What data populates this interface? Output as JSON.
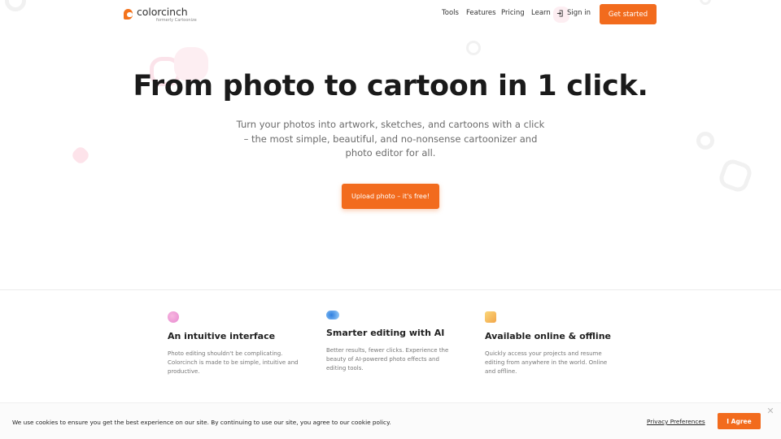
{
  "brand": {
    "name": "colorcinch",
    "tagline": "formerly Cartoonize",
    "accent_color": "#f26b1d"
  },
  "nav": {
    "items": [
      "Tools",
      "Features",
      "Pricing",
      "Learn"
    ],
    "signin_label": "Sign in",
    "get_started_label": "Get started"
  },
  "hero": {
    "title": "From photo to cartoon in 1 click.",
    "subtitle": "Turn your photos into artwork, sketches, and cartoons with a click – the most simple, beautiful, and no-nonsense cartoonizer and photo editor for all.",
    "cta_label": "Upload photo – it's free!"
  },
  "features": [
    {
      "icon": "palette-blob-icon",
      "icon_color": "#f5a3d6",
      "title": "An intuitive interface",
      "description": "Photo editing shouldn't be complicating. Colorcinch is made to be simple, intuitive and productive."
    },
    {
      "icon": "ai-spark-icon",
      "icon_color": "#5aa8f0",
      "title": "Smarter editing with AI",
      "description": "Better results, fewer clicks. Experience the beauty of AI-powered photo effects and editing tools."
    },
    {
      "icon": "online-offline-icon",
      "icon_color": "#f7c24a",
      "title": "Available online & offline",
      "description": "Quickly access your projects and resume editing from anywhere in the world. Online and offline."
    }
  ],
  "cookie": {
    "message": "We use cookies to ensure you get the best experience on our site. By continuing to use our site, you agree to our cookie policy.",
    "preferences_label": "Privacy Preferences",
    "agree_label": "I Agree",
    "close_glyph": "✕"
  }
}
